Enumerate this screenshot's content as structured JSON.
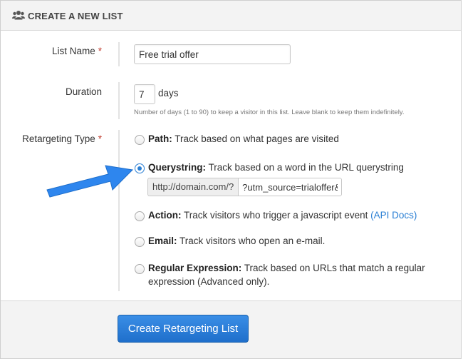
{
  "header": {
    "title": "CREATE A NEW LIST",
    "icon": "users-icon"
  },
  "list_name": {
    "label": "List Name",
    "required_mark": "*",
    "value": "Free trial offer"
  },
  "duration": {
    "label": "Duration",
    "value": "7",
    "unit": "days",
    "help": "Number of days (1 to 90) to keep a visitor in this list. Leave blank to keep them indefinitely."
  },
  "retargeting_type": {
    "label": "Retargeting Type",
    "required_mark": "*",
    "options": [
      {
        "title": "Path:",
        "description": "Track based on what pages are visited",
        "selected": false
      },
      {
        "title": "Querystring:",
        "description": "Track based on a word in the URL querystring",
        "selected": true
      },
      {
        "title": "Action:",
        "description": "Track visitors who trigger a javascript event",
        "link": "(API Docs)",
        "selected": false
      },
      {
        "title": "Email:",
        "description": "Track visitors who open an e-mail.",
        "selected": false
      },
      {
        "title": "Regular Expression:",
        "description": "Track based on URLs that match a regular expression (Advanced only).",
        "selected": false
      }
    ],
    "querystring": {
      "prefix": "http://domain.com/?",
      "value": "?utm_source=trialoffer&"
    }
  },
  "submit": {
    "label": "Create Retargeting List"
  },
  "colors": {
    "accent": "#2a7fd4",
    "button": "#1f6fcb",
    "arrow": "#2e86ee",
    "required": "#c0392b"
  }
}
